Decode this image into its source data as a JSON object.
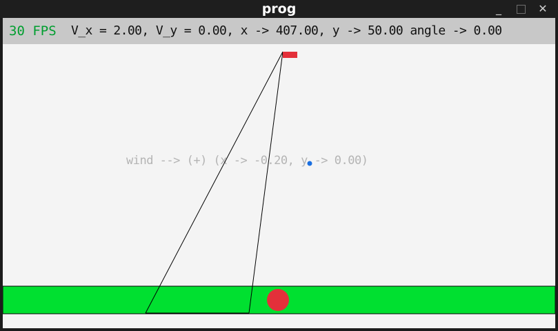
{
  "window": {
    "title": "prog",
    "controls": {
      "minimize": "_",
      "close": "✕"
    }
  },
  "hud": {
    "fps": "30 FPS",
    "stats": "V_x = 2.00, V_y = 0.00, x -> 407.00, y -> 50.00 angle -> 0.00"
  },
  "wind": {
    "label": "wind --> (+) (x -> -0.20, y -> 0.00)"
  },
  "colors": {
    "ground": "#00e030",
    "ball": "#e3303a",
    "anchor": "#e3303a",
    "wind_dot": "#1a6fe0",
    "fps_text": "#009e2f",
    "hud_bg": "#c8c8c8",
    "canvas_bg": "#f4f4f4"
  }
}
